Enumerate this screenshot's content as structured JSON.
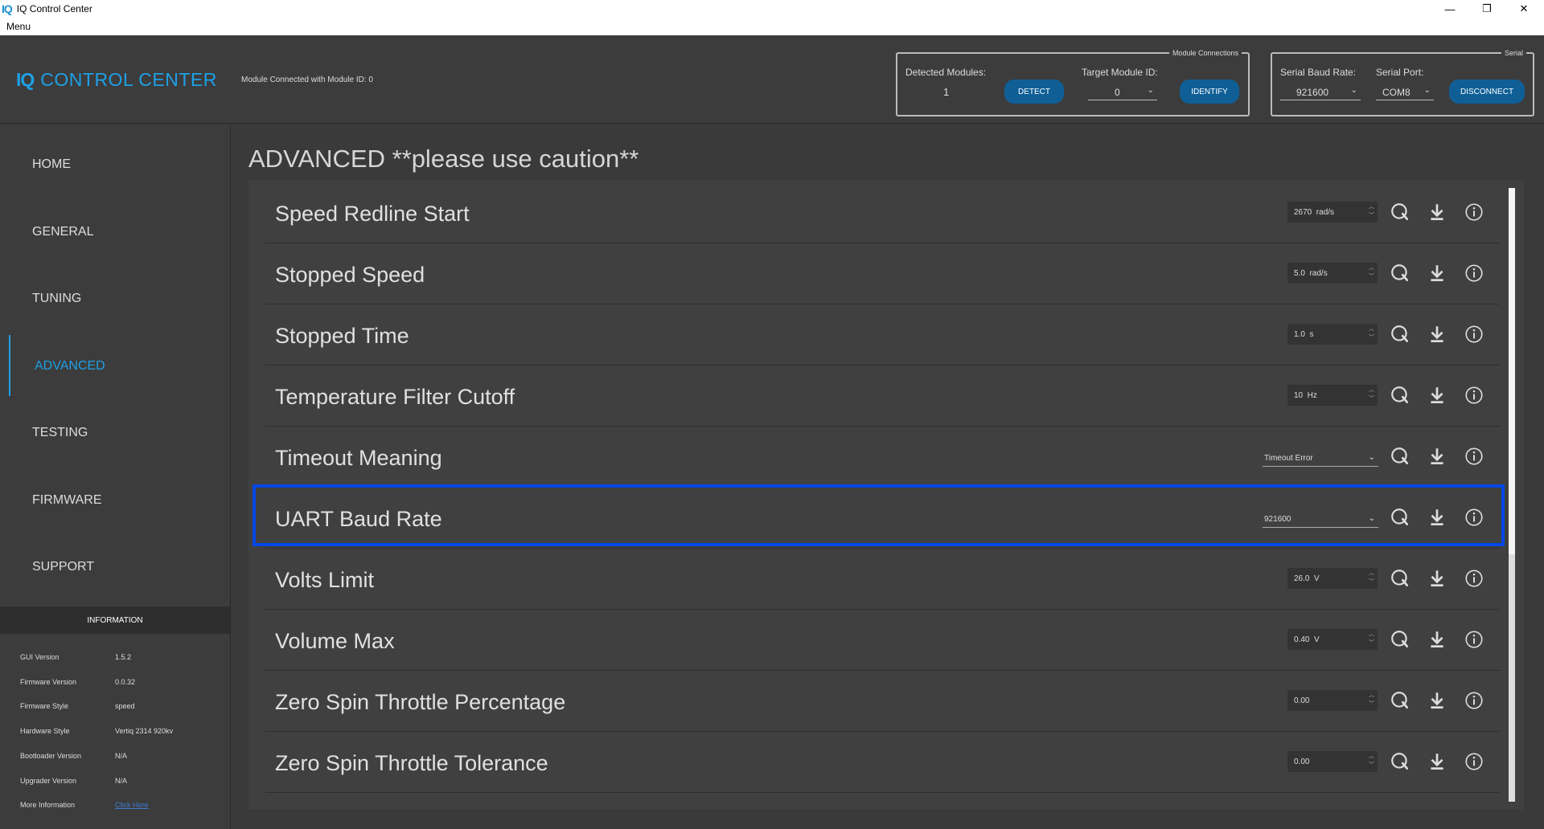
{
  "window": {
    "app_icon": "IQ",
    "title": "IQ Control Center",
    "minimize": "—",
    "maximize": "❐",
    "close": "✕"
  },
  "menubar": {
    "menu_label": "Menu"
  },
  "header": {
    "logo_iq": "IQ",
    "logo_text": "CONTROL CENTER",
    "connection_status": "Module Connected with Module ID: 0",
    "module_connections": {
      "legend": "Module Connections",
      "detected_label": "Detected Modules:",
      "detected_value": "1",
      "detect_button": "DETECT",
      "target_label": "Target Module ID:",
      "target_value": "0",
      "identify_button": "IDENTIFY"
    },
    "serial": {
      "legend": "Serial",
      "baud_label": "Serial Baud Rate:",
      "baud_value": "921600",
      "port_label": "Serial Port:",
      "port_value": "COM8",
      "disconnect_button": "DISCONNECT"
    }
  },
  "sidebar": {
    "items": [
      {
        "label": "HOME"
      },
      {
        "label": "GENERAL"
      },
      {
        "label": "TUNING"
      },
      {
        "label": "ADVANCED",
        "active": true
      },
      {
        "label": "TESTING"
      },
      {
        "label": "FIRMWARE"
      },
      {
        "label": "SUPPORT"
      }
    ],
    "accent": "#1ea0e6"
  },
  "information": {
    "heading": "INFORMATION",
    "rows": [
      {
        "label": "GUI Version",
        "value": "1.5.2"
      },
      {
        "label": "Firmware Version",
        "value": "0.0.32"
      },
      {
        "label": "Firmware Style",
        "value": "speed"
      },
      {
        "label": "Hardware Style",
        "value": "Vertiq 2314 920kv"
      },
      {
        "label": "Bootloader Version",
        "value": "N/A"
      },
      {
        "label": "Upgrader Version",
        "value": "N/A"
      },
      {
        "label": "More Information",
        "value": "Click Here"
      }
    ]
  },
  "main": {
    "page_title": "ADVANCED **please use caution**",
    "params": [
      {
        "label": "Speed Redline Start",
        "type": "spin",
        "value": "2670  rad/s"
      },
      {
        "label": "Stopped Speed",
        "type": "spin",
        "value": "5.0  rad/s"
      },
      {
        "label": "Stopped Time",
        "type": "spin",
        "value": "1.0  s"
      },
      {
        "label": "Temperature Filter Cutoff",
        "type": "spin",
        "value": "10  Hz"
      },
      {
        "label": "Timeout Meaning",
        "type": "combo",
        "value": "Timeout Error"
      },
      {
        "label": "UART Baud Rate",
        "type": "combo",
        "value": "921600",
        "highlighted": true
      },
      {
        "label": "Volts Limit",
        "type": "spin",
        "value": "26.0  V"
      },
      {
        "label": "Volume Max",
        "type": "spin",
        "value": "0.40  V"
      },
      {
        "label": "Zero Spin Throttle Percentage",
        "type": "spin",
        "value": "0.00"
      },
      {
        "label": "Zero Spin Throttle Tolerance",
        "type": "spin",
        "value": "0.00"
      }
    ],
    "row_icons": [
      "refresh-icon",
      "download-icon",
      "info-icon"
    ],
    "highlight_color": "#0047e6"
  }
}
